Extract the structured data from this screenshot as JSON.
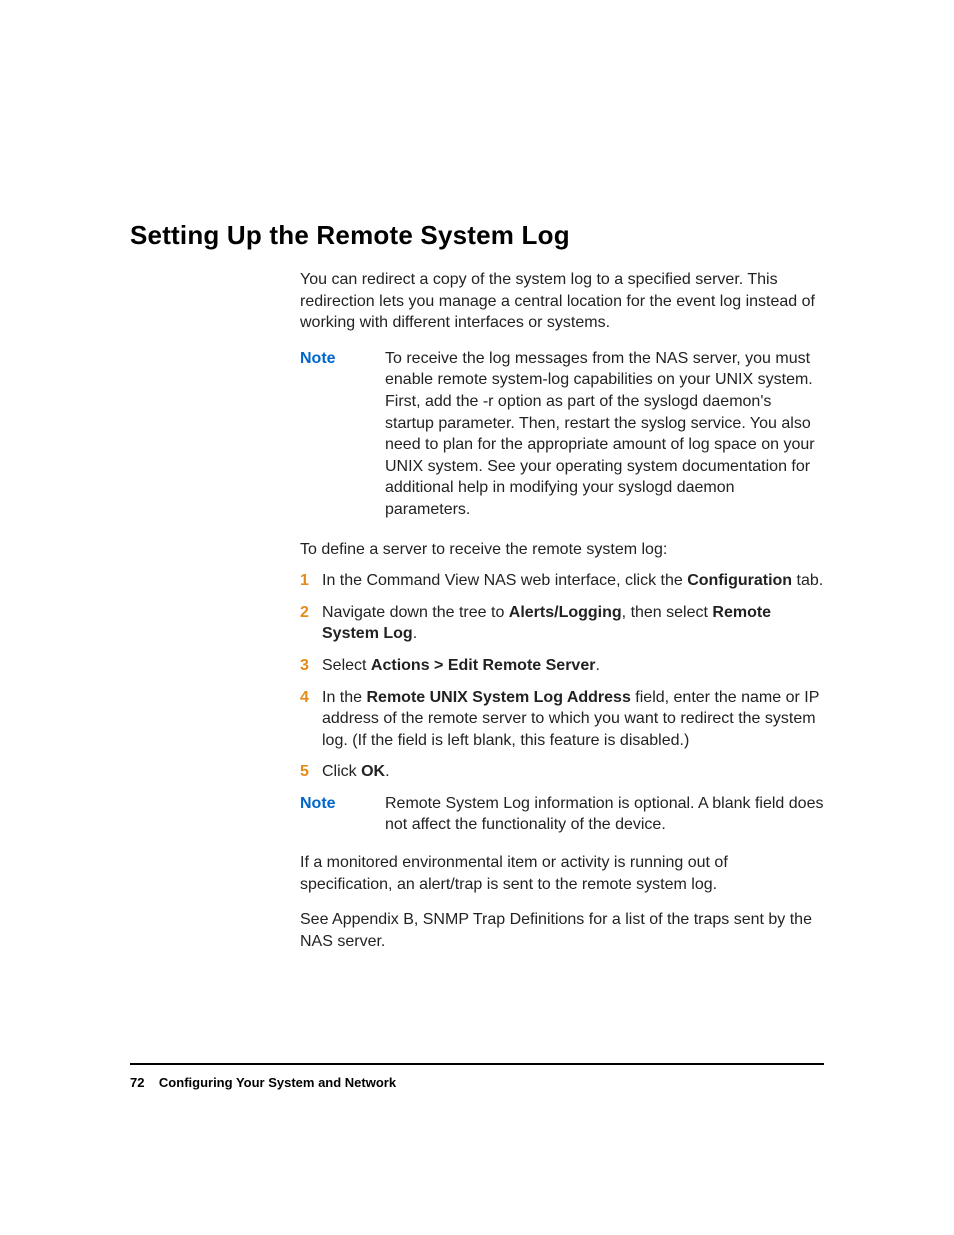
{
  "heading": "Setting Up the Remote System Log",
  "intro": "You can redirect a copy of the system log to a specified server. This redirection lets you manage a central location for the event log instead of working with different interfaces or systems.",
  "note1": {
    "label": "Note",
    "body": "To receive the log messages from the NAS server, you must enable remote system-log capabilities on your UNIX system. First, add the -r option as part of the syslogd daemon's startup parameter. Then, restart the syslog service. You also need to plan for the appropriate amount of log space on your UNIX system. See your operating system documentation for additional help in modifying your syslogd daemon parameters."
  },
  "lead": "To define a server to receive the remote system log:",
  "steps": [
    {
      "num": "1",
      "pre": "In the Command View NAS web interface, click the ",
      "b1": "Configuration",
      "post": " tab."
    },
    {
      "num": "2",
      "pre": "Navigate down the tree to ",
      "b1": "Alerts/Logging",
      "mid": ", then select ",
      "b2": "Remote System Log",
      "post": "."
    },
    {
      "num": "3",
      "pre": "Select ",
      "b1": "Actions > Edit Remote Server",
      "post": "."
    },
    {
      "num": "4",
      "pre": "In the ",
      "b1": "Remote UNIX System Log Address",
      "post": " field, enter the name or IP address of the remote server to which you want to redirect the system log. (If the field is left blank, this feature is disabled.)"
    },
    {
      "num": "5",
      "pre": "Click ",
      "b1": "OK",
      "post": "."
    }
  ],
  "note2": {
    "label": "Note",
    "body": "Remote System Log information is optional. A blank field does not affect the functionality of the device."
  },
  "para_after1": "If a monitored environmental item or activity is running out of specification, an alert/trap is sent to the remote system log.",
  "para_after2": "See Appendix B, SNMP Trap Definitions for a list of the traps sent by the NAS server.",
  "footer": {
    "pagenum": "72",
    "chapter": "Configuring Your System and Network"
  }
}
